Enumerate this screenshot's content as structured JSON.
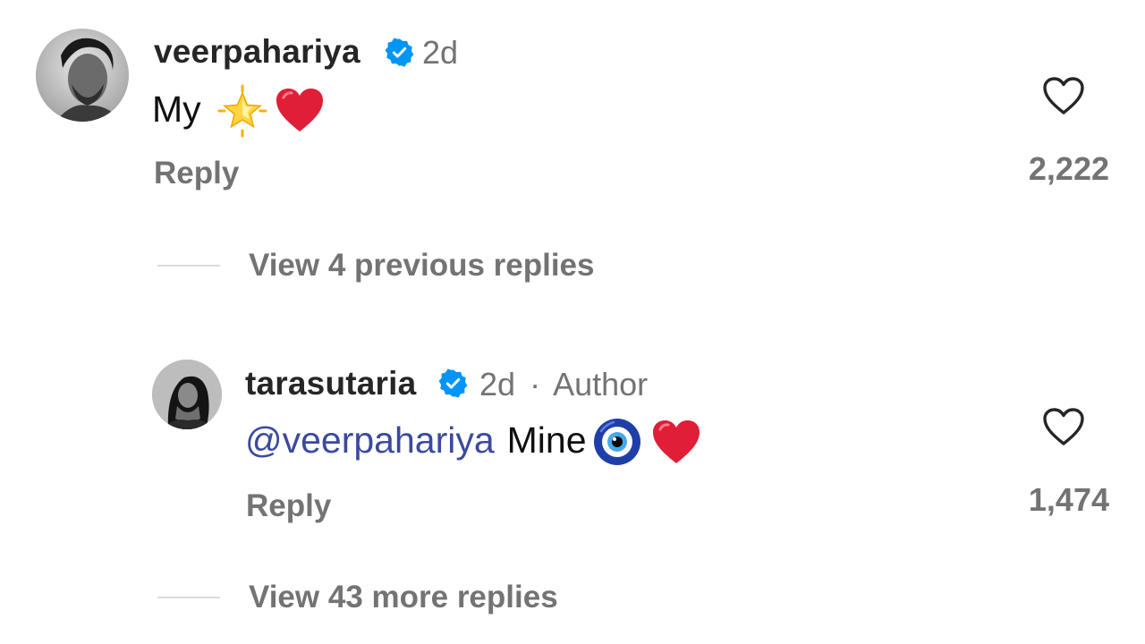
{
  "comment": {
    "username": "veerpahariya",
    "verified": true,
    "time": "2d",
    "text": "My",
    "emojis": [
      "glowing-star",
      "red-heart"
    ],
    "reply_label": "Reply",
    "like_count": "2,222"
  },
  "view_previous": {
    "label": "View 4 previous replies"
  },
  "reply": {
    "username": "tarasutaria",
    "verified": true,
    "time": "2d",
    "separator": "·",
    "author_badge": "Author",
    "mention": "@veerpahariya",
    "text": "Mine",
    "emojis": [
      "nazar-amulet",
      "red-heart"
    ],
    "reply_label": "Reply",
    "like_count": "1,474"
  },
  "view_more": {
    "label": "View 43 more replies"
  },
  "colors": {
    "verified_badge": "#0095f6",
    "mention": "#3b4a9e",
    "secondary_text": "#737373",
    "heart_emoji": "#e01e37"
  }
}
